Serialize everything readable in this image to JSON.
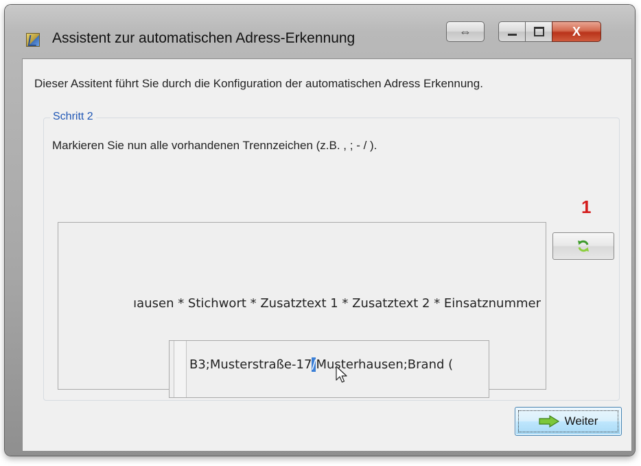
{
  "window": {
    "title": "Assistent zur automatischen Adress-Erkennung",
    "controls": {
      "resize": "⇔",
      "close": "X"
    }
  },
  "intro_text": "Dieser Assitent führt Sie durch die Konfiguration der automatischen Adress Erkennung.",
  "step": {
    "label": "Schritt 2",
    "description": "Markieren Sie nun alle vorhandenen Trennzeichen (z.B. , ; - / ).",
    "field_preview": "ıausen * Stichwort * Zusatztext 1 * Zusatztext 2 * Einsatznummer",
    "annotation_number": "1",
    "sample": {
      "before": "B3;Musterstraße-17",
      "selected": "/",
      "after": "Musterhausen;Brand ("
    }
  },
  "buttons": {
    "refresh_icon": "refresh-icon",
    "next_label": "Weiter",
    "next_icon": "arrow-right-icon"
  },
  "colors": {
    "legend_blue": "#1f56b5",
    "annotation_red": "#d41c1c",
    "selection_blue": "#3b7fd6",
    "close_red": "#c9432a"
  }
}
